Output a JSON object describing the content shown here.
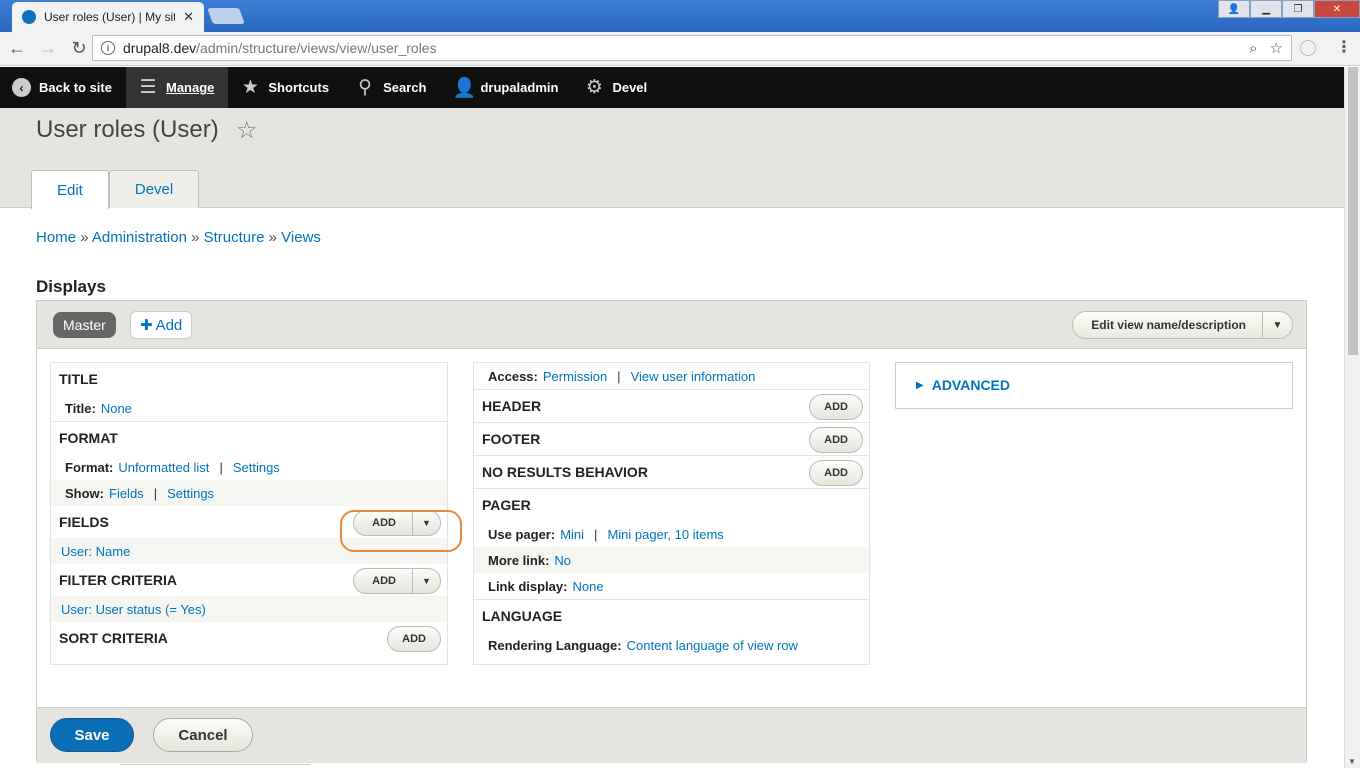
{
  "browser": {
    "tab_title": "User roles (User) | My site",
    "url_host": "drupal8.dev",
    "url_path": "/admin/structure/views/view/user_roles"
  },
  "admin_toolbar": {
    "back": "Back to site",
    "manage": "Manage",
    "shortcuts": "Shortcuts",
    "search": "Search",
    "user": "drupaladmin",
    "devel": "Devel"
  },
  "page": {
    "title": "User roles (User)",
    "tabs": [
      {
        "label": "Edit"
      },
      {
        "label": "Devel"
      }
    ]
  },
  "breadcrumb": [
    "Home",
    "Administration",
    "Structure",
    "Views"
  ],
  "breadcrumb_sep": "»",
  "displays": {
    "heading": "Displays",
    "master": "Master",
    "add": "Add",
    "edit_name": "Edit view name/description"
  },
  "left": {
    "title": {
      "heading": "TITLE",
      "label": "Title:",
      "value": "None"
    },
    "format": {
      "heading": "FORMAT",
      "format_label": "Format:",
      "format_value": "Unformatted list",
      "format_settings": "Settings",
      "show_label": "Show:",
      "show_value": "Fields",
      "show_settings": "Settings"
    },
    "fields": {
      "heading": "FIELDS",
      "add": "Add",
      "item": "User: Name"
    },
    "filter": {
      "heading": "FILTER CRITERIA",
      "add": "Add",
      "item": "User: User status (= Yes)"
    },
    "sort": {
      "heading": "SORT CRITERIA",
      "add": "Add"
    }
  },
  "middle": {
    "access": {
      "label": "Access:",
      "value": "Permission",
      "detail": "View user information"
    },
    "header": {
      "heading": "HEADER",
      "add": "Add"
    },
    "footer": {
      "heading": "FOOTER",
      "add": "Add"
    },
    "no_results": {
      "heading": "NO RESULTS BEHAVIOR",
      "add": "Add"
    },
    "pager": {
      "heading": "PAGER",
      "use_label": "Use pager:",
      "use_value": "Mini",
      "use_detail": "Mini pager, 10 items",
      "more_label": "More link:",
      "more_value": "No",
      "link_label": "Link display:",
      "link_value": "None"
    },
    "language": {
      "heading": "LANGUAGE",
      "label": "Rendering Language:",
      "value": "Content language of view row"
    }
  },
  "right": {
    "advanced": "ADVANCED"
  },
  "actions": {
    "save": "Save",
    "cancel": "Cancel"
  },
  "colors": {
    "link": "#0074bd",
    "save": "#0d6eb8",
    "highlight": "#e88c3c",
    "admin_bar": "#0f0f0f"
  }
}
